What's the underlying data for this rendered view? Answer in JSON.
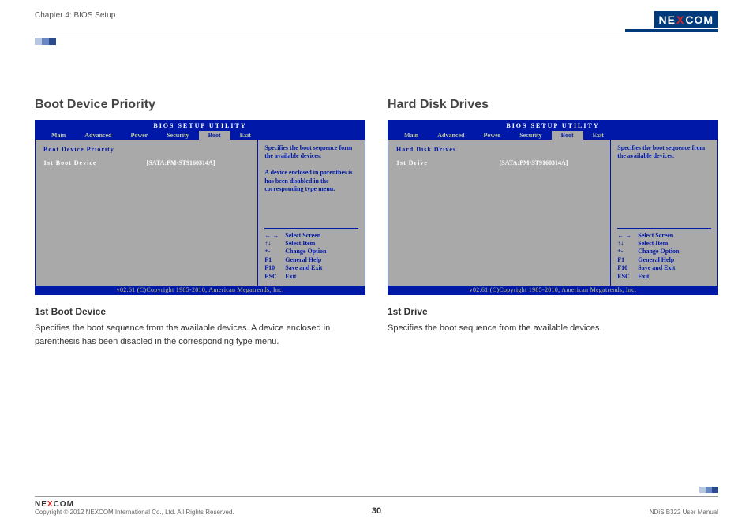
{
  "header": {
    "chapter": "Chapter 4: BIOS Setup",
    "logo": {
      "left": "NE",
      "x": "X",
      "right": "COM"
    }
  },
  "left": {
    "heading": "Boot Device Priority",
    "bios": {
      "title": "BIOS  SETUP  UTILITY",
      "menu": [
        "Main",
        "Advanced",
        "Power",
        "Security",
        "Boot",
        "Exit"
      ],
      "active_menu": "Boot",
      "subhead": "Boot  Device  Priority",
      "row_label": "1st  Boot  Device",
      "row_value": "[SATA:PM-ST9160314A]",
      "hint": "Specifies the boot sequence form the available devices.\n\nA device enclosed in parenthes is has been disabled in the corresponding type menu.",
      "keys": [
        {
          "k": "← →",
          "v": "Select Screen"
        },
        {
          "k": "↑↓",
          "v": "Select Item"
        },
        {
          "k": "+-",
          "v": "Change Option"
        },
        {
          "k": "F1",
          "v": "General Help"
        },
        {
          "k": "F10",
          "v": "Save and Exit"
        },
        {
          "k": "ESC",
          "v": "Exit"
        }
      ],
      "footer": "v02.61 (C)Copyright 1985-2010, American Megatrends, Inc."
    },
    "subheading": "1st Boot Device",
    "text": "Specifies the boot sequence from the available devices. A device enclosed in parenthesis has been disabled in the corresponding type menu."
  },
  "right": {
    "heading": "Hard Disk Drives",
    "bios": {
      "title": "BIOS  SETUP  UTILITY",
      "menu": [
        "Main",
        "Advanced",
        "Power",
        "Security",
        "Boot",
        "Exit"
      ],
      "active_menu": "Boot",
      "subhead": "Hard  Disk  Drives",
      "row_label": "1st  Drive",
      "row_value": "[SATA:PM-ST9160314A]",
      "hint": "Specifies the boot sequence from the available devices.",
      "keys": [
        {
          "k": "← →",
          "v": "Select Screen"
        },
        {
          "k": "↑↓",
          "v": "Select Item"
        },
        {
          "k": "+-",
          "v": "Change Option"
        },
        {
          "k": "F1",
          "v": "General Help"
        },
        {
          "k": "F10",
          "v": "Save and Exit"
        },
        {
          "k": "ESC",
          "v": "Exit"
        }
      ],
      "footer": "v02.61 (C)Copyright 1985-2010, American Megatrends, Inc."
    },
    "subheading": "1st Drive",
    "text": "Specifies the boot sequence from the available devices."
  },
  "footer": {
    "copyright": "Copyright © 2012 NEXCOM International Co., Ltd. All Rights Reserved.",
    "page": "30",
    "manual": "NDiS B322 User Manual"
  }
}
